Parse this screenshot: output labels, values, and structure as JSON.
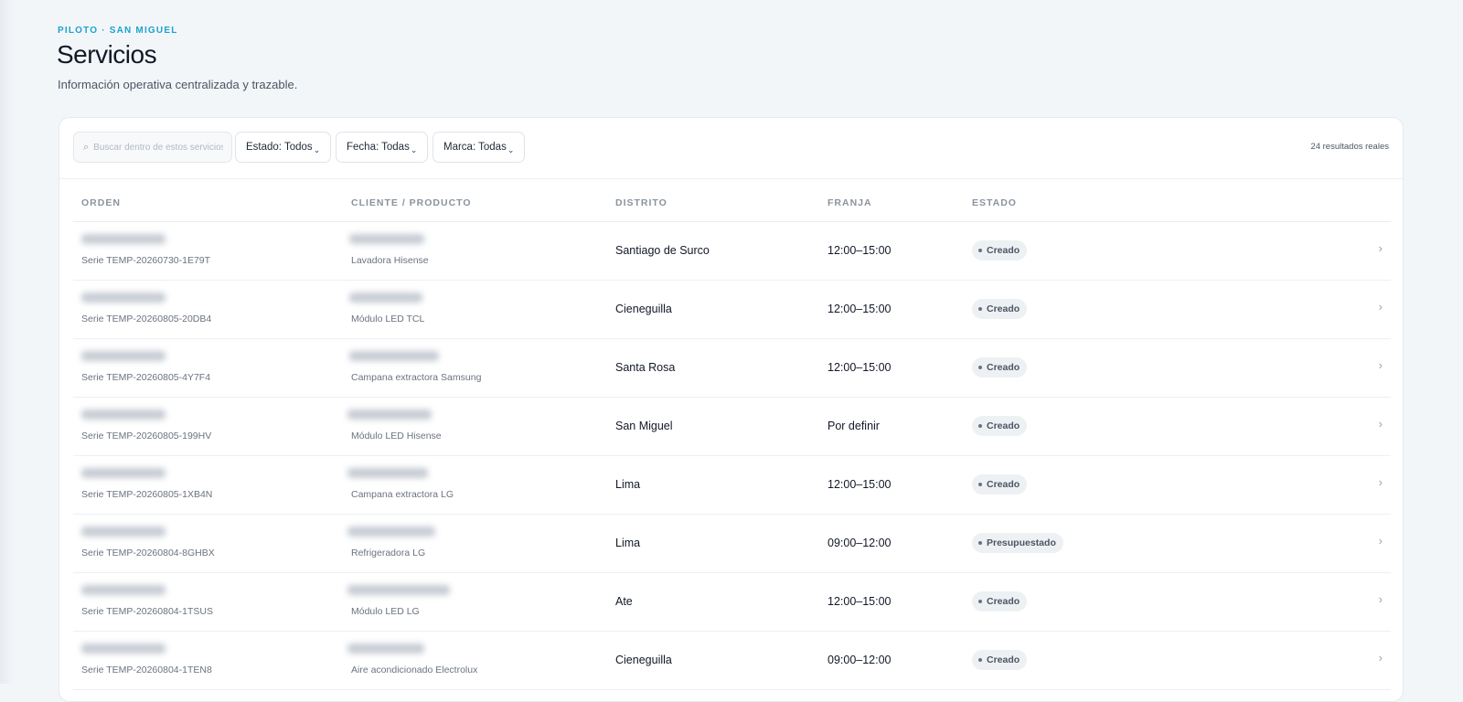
{
  "header": {
    "eyebrow": "PILOTO · SAN MIGUEL",
    "title": "Servicios",
    "subtitle": "Información operativa centralizada y trazable."
  },
  "toolbar": {
    "search_placeholder": "Buscar dentro de estos servicios",
    "filters": {
      "estado": "Estado: Todos",
      "fecha": "Fecha: Todas",
      "marca": "Marca: Todas"
    },
    "chevron": "⌄",
    "results": "24 resultados reales"
  },
  "table": {
    "columns": {
      "orden": "ORDEN",
      "cliente": "CLIENTE / PRODUCTO",
      "distrito": "DISTRITO",
      "franja": "FRANJA",
      "estado": "ESTADO"
    },
    "rows": [
      {
        "serie": "Serie TEMP-20260730-1E79T",
        "product": "Lavadora Hisense",
        "district": "Santiago de Surco",
        "slot": "12:00–15:00",
        "status": "Creado"
      },
      {
        "serie": "Serie TEMP-20260805-20DB4",
        "product": "Módulo LED TCL",
        "district": "Cieneguilla",
        "slot": "12:00–15:00",
        "status": "Creado"
      },
      {
        "serie": "Serie TEMP-20260805-4Y7F4",
        "product": "Campana extractora Samsung",
        "district": "Santa Rosa",
        "slot": "12:00–15:00",
        "status": "Creado"
      },
      {
        "serie": "Serie TEMP-20260805-199HV",
        "product": "Módulo LED Hisense",
        "district": "San Miguel",
        "slot": "Por definir",
        "status": "Creado"
      },
      {
        "serie": "Serie TEMP-20260805-1XB4N",
        "product": "Campana extractora LG",
        "district": "Lima",
        "slot": "12:00–15:00",
        "status": "Creado"
      },
      {
        "serie": "Serie TEMP-20260804-8GHBX",
        "product": "Refrigeradora LG",
        "district": "Lima",
        "slot": "09:00–12:00",
        "status": "Presupuestado"
      },
      {
        "serie": "Serie TEMP-20260804-1TSUS",
        "product": "Módulo LED LG",
        "district": "Ate",
        "slot": "12:00–15:00",
        "status": "Creado"
      },
      {
        "serie": "Serie TEMP-20260804-1TEN8",
        "product": "Aire acondicionado Electrolux",
        "district": "Cieneguilla",
        "slot": "09:00–12:00",
        "status": "Creado"
      }
    ],
    "row_chevron": "›"
  },
  "colors": {
    "accent": "#1aa3cf",
    "background": "#f3f6f9",
    "badge_bg": "#eef1f4"
  },
  "icons": {
    "search": "search-icon",
    "row": "chevron-right-icon",
    "filter": "chevron-down-icon"
  }
}
